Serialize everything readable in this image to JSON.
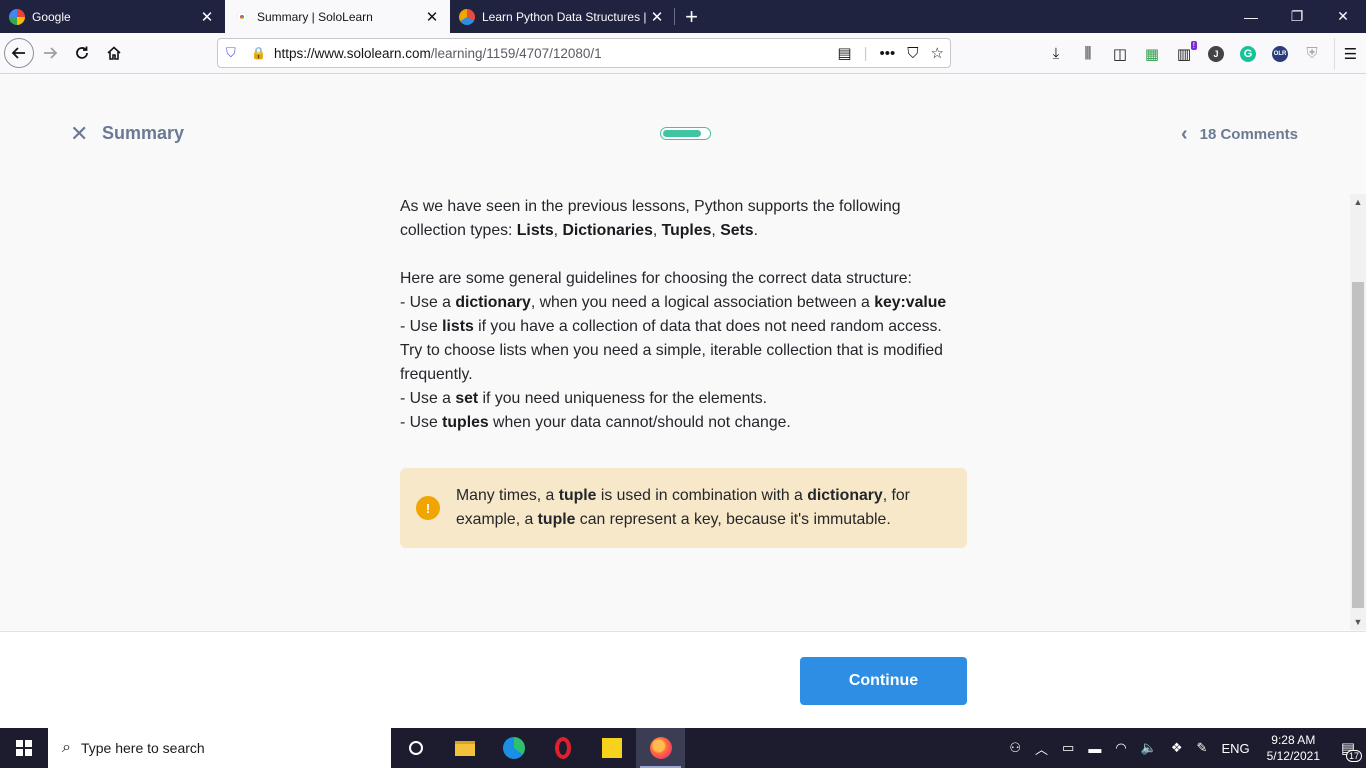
{
  "browser": {
    "tabs": [
      {
        "label": "Google",
        "active": false
      },
      {
        "label": "Summary | SoloLearn",
        "active": true
      },
      {
        "label": "Learn Python Data Structures |",
        "active": false
      }
    ],
    "url_host": "https://www.sololearn.com",
    "url_path": "/learning/1159/4707/12080/1",
    "new_tab_symbol": "+",
    "notification_badge": "!",
    "profile_initial": "J",
    "extension_label": "OLR"
  },
  "lesson": {
    "title": "Summary",
    "comments_label": "18 Comments",
    "progress_fraction": 0.85
  },
  "content": {
    "p1_a": "As we have seen in the previous lessons, Python supports the following collection types: ",
    "p1_lists": "Lists",
    "p1_sep1": ", ",
    "p1_dicts": "Dictionaries",
    "p1_sep2": ", ",
    "p1_tuples": "Tuples",
    "p1_sep3": ", ",
    "p1_sets": "Sets",
    "p1_end": ".",
    "p2_intro": "Here are some general guidelines for choosing the correct data structure:",
    "b1_a": "- Use a ",
    "b1_bold": "dictionary",
    "b1_b": ", when you need a logical association between a ",
    "b1_bold2": "key:value",
    "b2_a": "- Use ",
    "b2_bold": "lists",
    "b2_b": " if you have a collection of data that does not need random access. Try to choose lists when you need a simple, iterable collection that is modified frequently.",
    "b3_a": "- Use a ",
    "b3_bold": "set",
    "b3_b": " if you need uniqueness for the elements.",
    "b4_a": "- Use ",
    "b4_bold": "tuples",
    "b4_b": " when your data cannot/should not change."
  },
  "note": {
    "icon": "!",
    "a": "Many times, a ",
    "tuple1": "tuple",
    "b": " is used in combination with a ",
    "dict": "dictionary",
    "c": ", for example, a ",
    "tuple2": "tuple",
    "d": " can represent a key, because it's immutable."
  },
  "footer": {
    "continue_label": "Continue"
  },
  "taskbar": {
    "search_placeholder": "Type here to search",
    "language": "ENG",
    "time": "9:28 AM",
    "date": "5/12/2021",
    "notification_count": "17"
  }
}
